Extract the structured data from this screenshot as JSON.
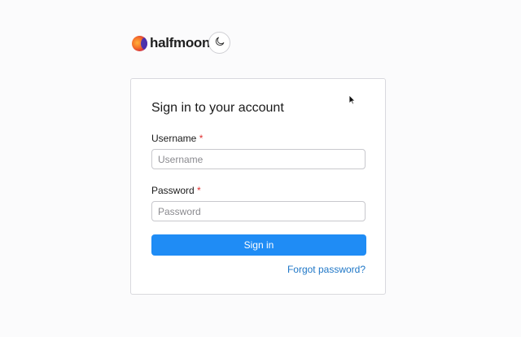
{
  "brand": {
    "name": "halfmoon"
  },
  "theme_toggle": {
    "icon": "moon-icon"
  },
  "card": {
    "title": "Sign in to your account",
    "username": {
      "label": "Username",
      "required_mark": "*",
      "placeholder": "Username",
      "value": ""
    },
    "password": {
      "label": "Password",
      "required_mark": "*",
      "placeholder": "Password",
      "value": ""
    },
    "submit_label": "Sign in",
    "forgot_label": "Forgot password?"
  },
  "colors": {
    "primary": "#1f8cf5",
    "link": "#1f77c7",
    "required": "#e03131"
  }
}
